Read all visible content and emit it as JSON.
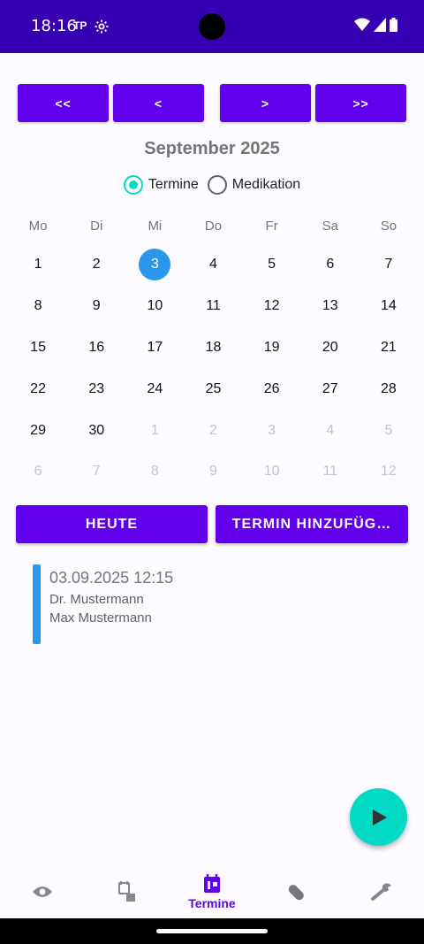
{
  "status": {
    "time": "18:16",
    "tp_label": "TP"
  },
  "nav": {
    "first": "<<",
    "prev": "<",
    "next": ">",
    "last": ">>"
  },
  "month_title": "September 2025",
  "filter": {
    "option1": "Termine",
    "option2": "Medikation",
    "selected": "Termine"
  },
  "weekdays": [
    "Mo",
    "Di",
    "Mi",
    "Do",
    "Fr",
    "Sa",
    "So"
  ],
  "days": [
    [
      "1",
      "2",
      "3",
      "4",
      "5",
      "6",
      "7"
    ],
    [
      "8",
      "9",
      "10",
      "11",
      "12",
      "13",
      "14"
    ],
    [
      "15",
      "16",
      "17",
      "18",
      "19",
      "20",
      "21"
    ],
    [
      "22",
      "23",
      "24",
      "25",
      "26",
      "27",
      "28"
    ],
    [
      "29",
      "30",
      "1",
      "2",
      "3",
      "4",
      "5"
    ],
    [
      "6",
      "7",
      "8",
      "9",
      "10",
      "11",
      "12"
    ]
  ],
  "selected_day": "3",
  "actions": {
    "today": "HEUTE",
    "add": "TERMIN HINZUFÜG…"
  },
  "appointment": {
    "datetime": "03.09.2025 12:15",
    "doctor": "Dr. Mustermann",
    "patient": "Max Mustermann",
    "color": "#2b97ea"
  },
  "bottom_nav": {
    "active_label": "Termine"
  },
  "colors": {
    "primary": "#6200ee",
    "status_bar": "#3700b3",
    "accent": "#03dac5",
    "selected_day": "#2b97ea"
  }
}
